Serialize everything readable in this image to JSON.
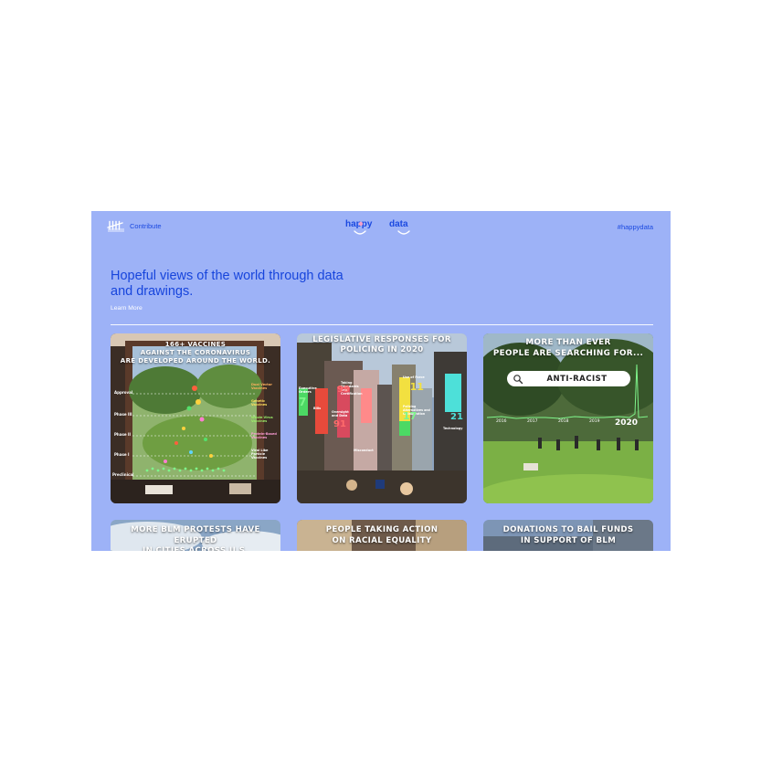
{
  "header": {
    "contribute_label": "Contribute",
    "logo_word1": "happy",
    "logo_word2": "data",
    "hashtag": "#happydata"
  },
  "hero": {
    "title": "Hopeful views of the world through data and drawings.",
    "learn_more": "Learn More"
  },
  "cards": [
    {
      "title": "166+ vaccines\nagainst the coronavirus\nare developed around the world.",
      "phases": [
        "Approval",
        "Phase III",
        "Phase II",
        "Phase I",
        "Preclinical"
      ],
      "legend": [
        "Dual Vector Vaccines",
        "Genetic Vaccines",
        "Whole Virus Vaccines",
        "Protein-Based Vaccines",
        "Viral Like Particle Vaccines"
      ]
    },
    {
      "title": "Legislative responses for\npolicing in 2020",
      "labels": [
        "Executive Orders",
        "Taking Standards and Certification",
        "Oversight and Data",
        "Use of Force",
        "Policing Alternatives and Collaboration",
        "Technology",
        "Misconduct"
      ],
      "values": [
        "7",
        "99",
        "91",
        "111",
        "17",
        "21"
      ],
      "unit": "Bills"
    },
    {
      "title": "More than ever\npeople are searching for...",
      "search_term": "ANTI-RACIST",
      "years": [
        "2016",
        "2017",
        "2018",
        "2019",
        "2020"
      ]
    },
    {
      "title": "More BLM protests have erupted\nin cities across U.S."
    },
    {
      "title": "People taking action\non racial equality"
    },
    {
      "title": "Donations to bail funds\nin support of BLM"
    }
  ],
  "colors": {
    "background": "#9db2f7",
    "link": "#1b49e0",
    "hero_title": "#1745dc",
    "logo_pink": "#f4a1c8"
  }
}
